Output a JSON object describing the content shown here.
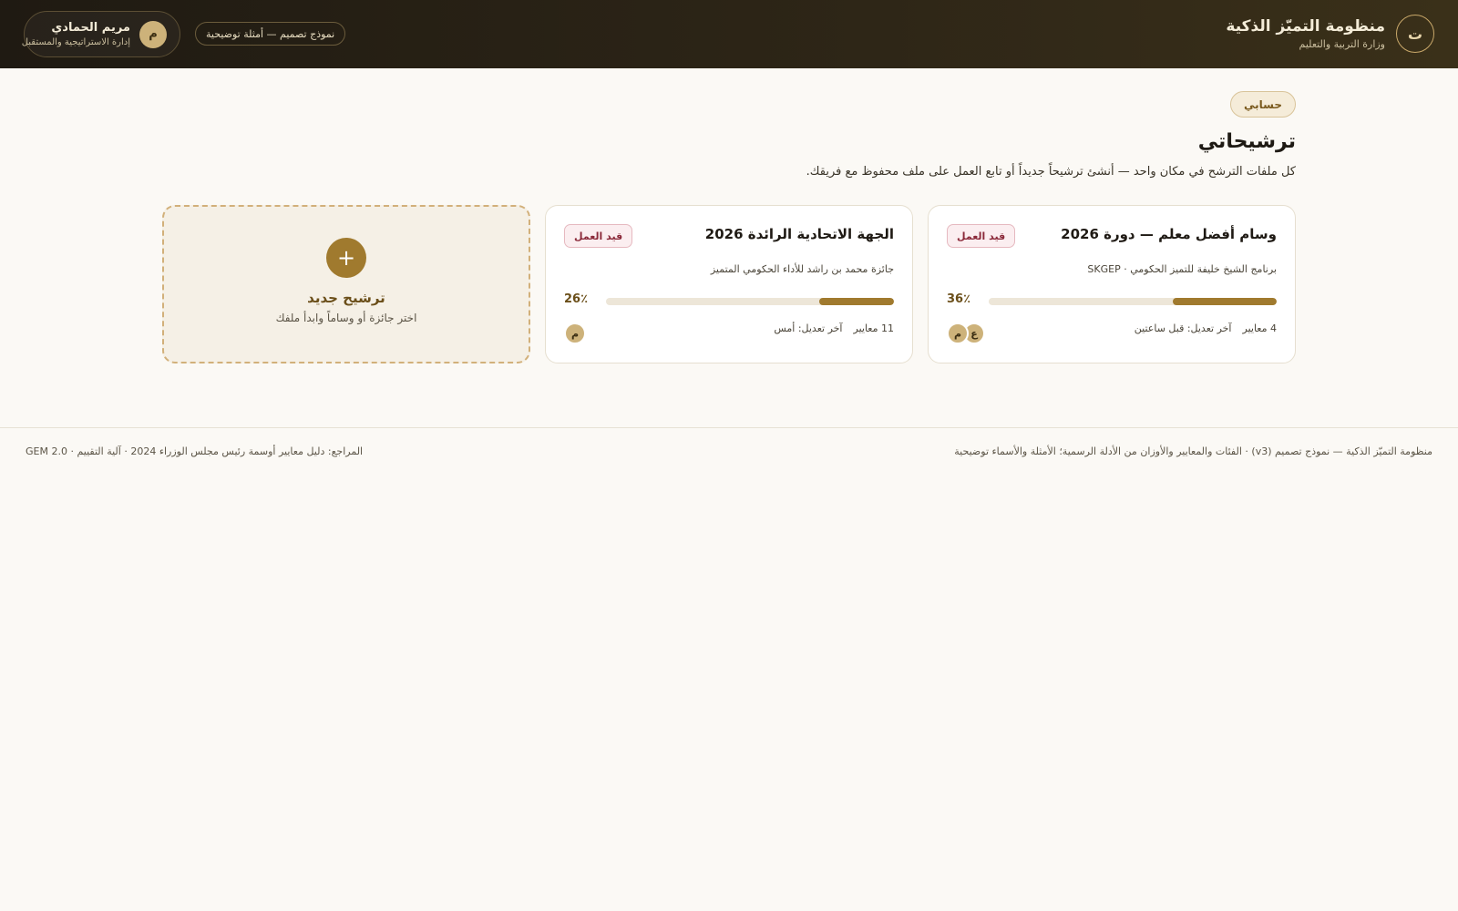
{
  "header": {
    "logo_letter": "ت",
    "title": "منظومة التميّز الذكية",
    "subtitle": "وزارة التربية والتعليم",
    "demo_pill": "نموذج تصميم — أمثلة توضيحية",
    "user": {
      "initial": "م",
      "name": "مريم الحمادي",
      "department": "إدارة الاستراتيجية والمستقبل"
    }
  },
  "breadcrumb": "حسابي",
  "page": {
    "title": "ترشيحاتي",
    "description": "كل ملفات الترشح في مكان واحد — أنشئ ترشيحاً جديداً أو تابع العمل على ملف محفوظ مع فريقك."
  },
  "nominations": [
    {
      "title": "وسام أفضل معلم — دورة 2026",
      "status": "قيد العمل",
      "program": "برنامج الشيخ خليفة للتميز الحكومي · SKGEP",
      "progress": 36,
      "progress_label": "36٪",
      "criteria": "4 معايير",
      "last_edit": "آخر تعديل: قبل ساعتين",
      "team": [
        "م",
        "ع"
      ]
    },
    {
      "title": "الجهة الاتحادية الرائدة 2026",
      "status": "قيد العمل",
      "program": "جائزة محمد بن راشد للأداء الحكومي المتميز",
      "progress": 26,
      "progress_label": "26٪",
      "criteria": "11 معايير",
      "last_edit": "آخر تعديل: أمس",
      "team": [
        "م"
      ]
    }
  ],
  "new_nomination": {
    "icon": "+",
    "title": "ترشيح جديد",
    "subtitle": "اختر جائزة أو وساماً وابدأ ملفك"
  },
  "footer": {
    "right": "منظومة التميّز الذكية — نموذج تصميم (v3) · الفئات والمعايير والأوزان من الأدلة الرسمية؛ الأمثلة والأسماء توضيحية",
    "left": "المراجع: دليل معايير أوسمة رئيس مجلس الوزراء 2024 · آلية التقييم · GEM 2.0"
  },
  "colors": {
    "header_bg": "#2e2617",
    "accent": "#a07a2e",
    "status_draft": "#8b2a3a"
  }
}
